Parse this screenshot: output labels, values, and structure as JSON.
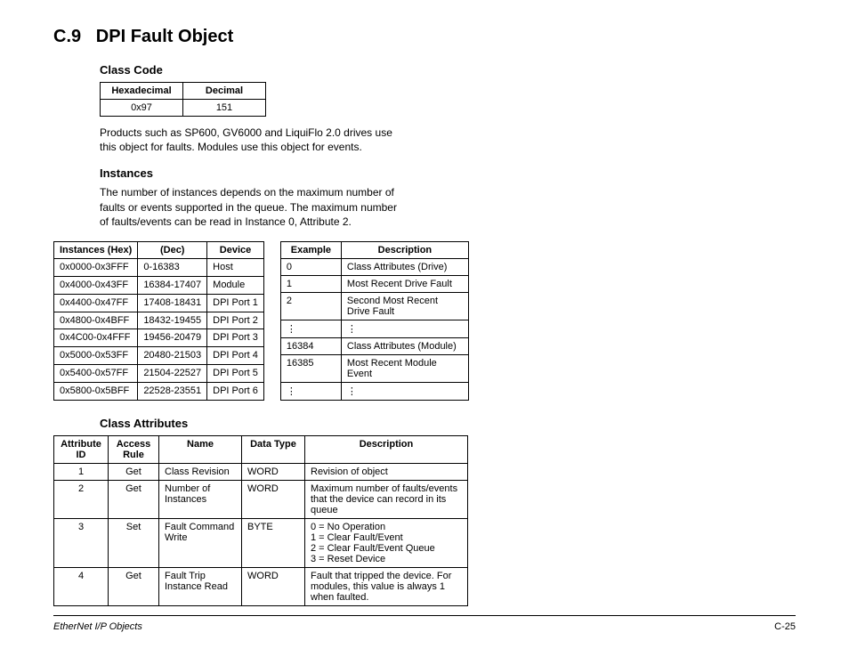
{
  "section": {
    "number": "C.9",
    "title": "DPI Fault Object"
  },
  "classCode": {
    "heading": "Class Code",
    "headers": [
      "Hexadecimal",
      "Decimal"
    ],
    "row": [
      "0x97",
      "151"
    ]
  },
  "intro": "Products such as SP600, GV6000 and LiquiFlo 2.0 drives use this object for faults. Modules use this object for events.",
  "instancesSection": {
    "heading": "Instances",
    "text": "The number of instances depends on the maximum number of faults or events supported in the queue. The maximum number of faults/events can be read in Instance 0, Attribute 2."
  },
  "instancesTable": {
    "headers": [
      "Instances (Hex)",
      "(Dec)",
      "Device"
    ],
    "rows": [
      [
        "0x0000-0x3FFF",
        "0-16383",
        "Host"
      ],
      [
        "0x4000-0x43FF",
        "16384-17407",
        "Module"
      ],
      [
        "0x4400-0x47FF",
        "17408-18431",
        "DPI Port 1"
      ],
      [
        "0x4800-0x4BFF",
        "18432-19455",
        "DPI Port 2"
      ],
      [
        "0x4C00-0x4FFF",
        "19456-20479",
        "DPI Port 3"
      ],
      [
        "0x5000-0x53FF",
        "20480-21503",
        "DPI Port 4"
      ],
      [
        "0x5400-0x57FF",
        "21504-22527",
        "DPI Port 5"
      ],
      [
        "0x5800-0x5BFF",
        "22528-23551",
        "DPI Port 6"
      ]
    ]
  },
  "exampleTable": {
    "headers": [
      "Example",
      "Description"
    ],
    "rows": [
      [
        "0",
        "Class Attributes (Drive)"
      ],
      [
        "1",
        "Most Recent Drive Fault"
      ],
      [
        "2",
        "Second Most Recent Drive Fault"
      ],
      [
        "⋮",
        "⋮"
      ],
      [
        "16384",
        "Class Attributes (Module)"
      ],
      [
        "16385",
        "Most Recent Module Event"
      ],
      [
        "⋮",
        "⋮"
      ]
    ]
  },
  "classAttrs": {
    "heading": "Class Attributes",
    "headers": [
      "Attribute ID",
      "Access Rule",
      "Name",
      "Data Type",
      "Description"
    ],
    "rows": [
      {
        "id": "1",
        "rule": "Get",
        "name": "Class Revision",
        "dtype": "WORD",
        "desc": "Revision of object"
      },
      {
        "id": "2",
        "rule": "Get",
        "name": "Number of Instances",
        "dtype": "WORD",
        "desc": "Maximum number of faults/events that the device can record in its queue"
      },
      {
        "id": "3",
        "rule": "Set",
        "name": "Fault Command Write",
        "dtype": "BYTE",
        "desc": "0 = No Operation\n1 = Clear Fault/Event\n2 = Clear Fault/Event Queue\n3 = Reset Device"
      },
      {
        "id": "4",
        "rule": "Get",
        "name": "Fault Trip Instance Read",
        "dtype": "WORD",
        "desc": "Fault that tripped the device. For modules, this value is always 1 when faulted."
      }
    ]
  },
  "footer": {
    "left": "EtherNet I/P Objects",
    "right": "C-25"
  }
}
